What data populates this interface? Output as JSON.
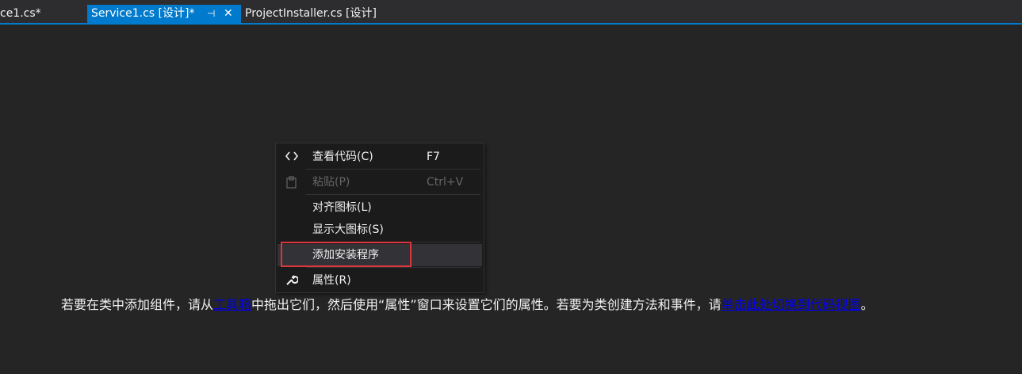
{
  "tabs": [
    {
      "label": "ce1.cs*"
    },
    {
      "label": "Service1.cs [设计]*",
      "pin": "⊣",
      "close": "✕"
    },
    {
      "label": "ProjectInstaller.cs [设计]"
    }
  ],
  "context_menu": {
    "items": [
      {
        "label": "查看代码(C)",
        "shortcut": "F7",
        "icon": "code-icon"
      },
      {
        "label": "粘贴(P)",
        "shortcut": "Ctrl+V",
        "icon": "paste-icon",
        "disabled": true
      },
      {
        "label": "对齐图标(L)"
      },
      {
        "label": "显示大图标(S)"
      },
      {
        "label": "添加安装程序",
        "highlighted": true
      },
      {
        "label": "属性(R)",
        "icon": "wrench-icon"
      }
    ]
  },
  "hint": {
    "part1": "若要在类中添加组件，请从",
    "link1": "工具箱",
    "part2": "中拖出它们，然后使用“属性”窗口来设置它们的属性。若要为类创建方法和事件，请",
    "link2": "单击此处切换到代码视图",
    "part3": "。"
  },
  "colors": {
    "accent": "#007acc",
    "background": "#252526",
    "menu_bg": "#1b1b1c",
    "highlight_box": "#d9363e",
    "link": "#0000ee"
  }
}
